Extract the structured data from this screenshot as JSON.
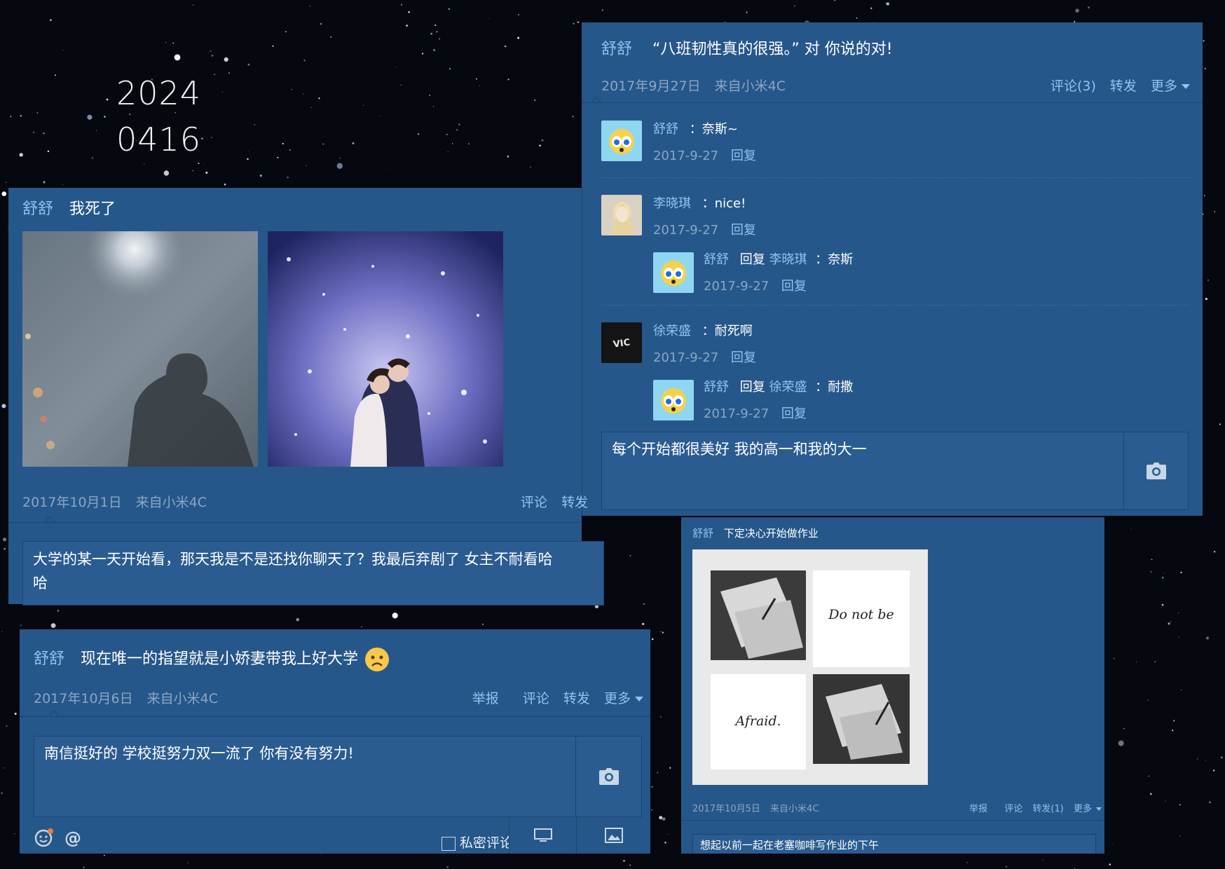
{
  "date_stamp": {
    "line1": "2024",
    "line2": "0416"
  },
  "posts": {
    "top_right": {
      "author": "舒舒",
      "text": "“八班韧性真的很强。” 对 你说的对!",
      "date": "2017年9月27日",
      "source": "来自小米4C",
      "actions": {
        "comment": "评论(3)",
        "repost": "转发",
        "more": "更多"
      },
      "comments": [
        {
          "author": "舒舒",
          "text": "：奈斯~",
          "time": "2017-9-27",
          "reply_label": "回复"
        },
        {
          "author": "李晓琪",
          "text": "：nice!",
          "time": "2017-9-27",
          "reply_label": "回复",
          "sub": {
            "author": "舒舒",
            "reply_word": "回复",
            "target": "李晓琪",
            "text": "：奈斯",
            "time": "2017-9-27",
            "reply_label": "回复"
          }
        },
        {
          "author": "徐荣盛",
          "text": "：耐死啊",
          "time": "2017-9-27",
          "reply_label": "回复",
          "sub": {
            "author": "舒舒",
            "reply_word": "回复",
            "target": "徐荣盛",
            "text": "：耐撒",
            "time": "2017-9-27",
            "reply_label": "回复"
          }
        }
      ],
      "reply_text": "每个开始都很美好   我的高一和我的大一"
    },
    "middle_left": {
      "author": "舒舒",
      "text": "我死了",
      "date": "2017年10月1日",
      "source": "来自小米4C",
      "actions": {
        "comment": "评论",
        "repost": "转发"
      },
      "reply_text": "大学的某一天开始看，那天我是不是还找你聊天了？我最后弃剧了   女主不耐看哈哈"
    },
    "bottom_left": {
      "author": "舒舒",
      "text": "现在唯一的指望就是小娇妻带我上好大学",
      "date": "2017年10月6日",
      "source": "来自小米4C",
      "actions": {
        "report": "举报",
        "comment": "评论",
        "repost": "转发",
        "more": "更多"
      },
      "reply_text": "南信挺好的   学校挺努力双一流了   你有没有努力!",
      "private_label": "私密评论"
    },
    "bottom_right": {
      "author": "舒舒",
      "text": "下定决心开始做作业",
      "date": "2017年10月5日",
      "source": "来自小米4C",
      "actions": {
        "report": "举报",
        "comment": "评论",
        "repost": "转发(1)",
        "more": "更多"
      },
      "collage_words": [
        "Do not be",
        "Afraid."
      ],
      "reply_text": "想起以前一起在老塞咖啡写作业的下午"
    }
  },
  "colors": {
    "card": "#26578a",
    "name": "#8fc4f2",
    "meta": "#8aa6c4",
    "space": "#06080f"
  },
  "icons": [
    "camera-icon",
    "emoji-icon",
    "at-icon",
    "checkbox-icon",
    "caret-down-icon",
    "frown-emoji-icon",
    "image-icon"
  ]
}
